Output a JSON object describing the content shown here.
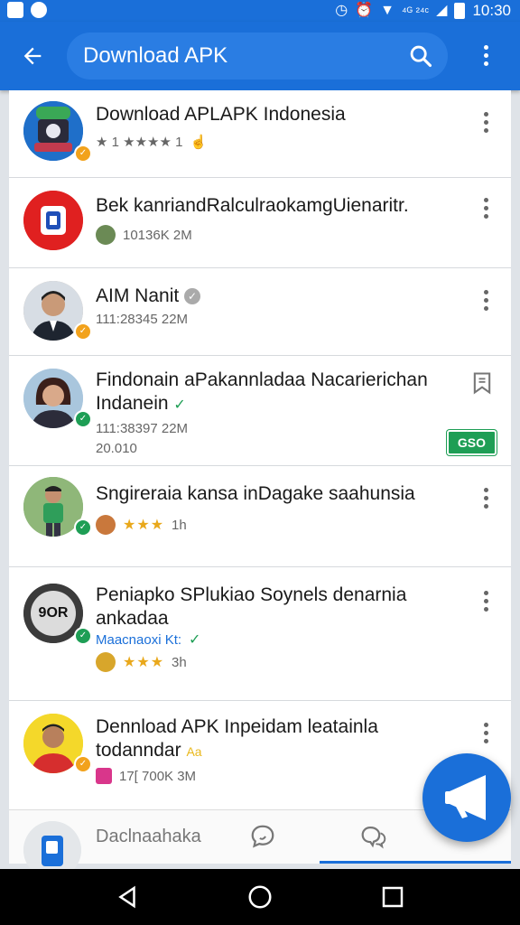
{
  "status_bar": {
    "signal_text": "⁴ᴳ ²⁴ᶜ",
    "clock": "10:30"
  },
  "app_bar": {
    "search_text": "Download APK"
  },
  "results": [
    {
      "title": "Download APLAPK Indonesia",
      "meta": "★ 1 ★★★★ 1"
    },
    {
      "title": "Bek kanriandRalculraokamgUienaritr.",
      "meta": "10136K 2M"
    },
    {
      "title": "AIM Nanit",
      "meta": "111:28345 22M"
    },
    {
      "title": "Findonain aPakannladaa Nacarierichan Indanein",
      "meta": "111:38397 22M",
      "meta2": "20.010",
      "price": "GSO"
    },
    {
      "title": "Sngireraia kansa inDagake saahunsia",
      "meta": "1h",
      "rating": "★★★"
    },
    {
      "title": "Peniapko SPlukiao Soynels denarnia ankadaa",
      "avatar_text": "9OR",
      "meta": "Maacnaoxi Kt:",
      "rating": "★★★",
      "meta2": "3h"
    },
    {
      "title": "Dennload APK Inpeidam leatainla todanndar",
      "title_suffix": "Aa",
      "meta": "17[ 700K 3M"
    }
  ],
  "tabbar": {
    "label": "Daclnaahaka"
  },
  "colors": {
    "primary": "#1a6fd9",
    "accent_green": "#1e9e55",
    "accent_orange": "#f2a21c"
  }
}
